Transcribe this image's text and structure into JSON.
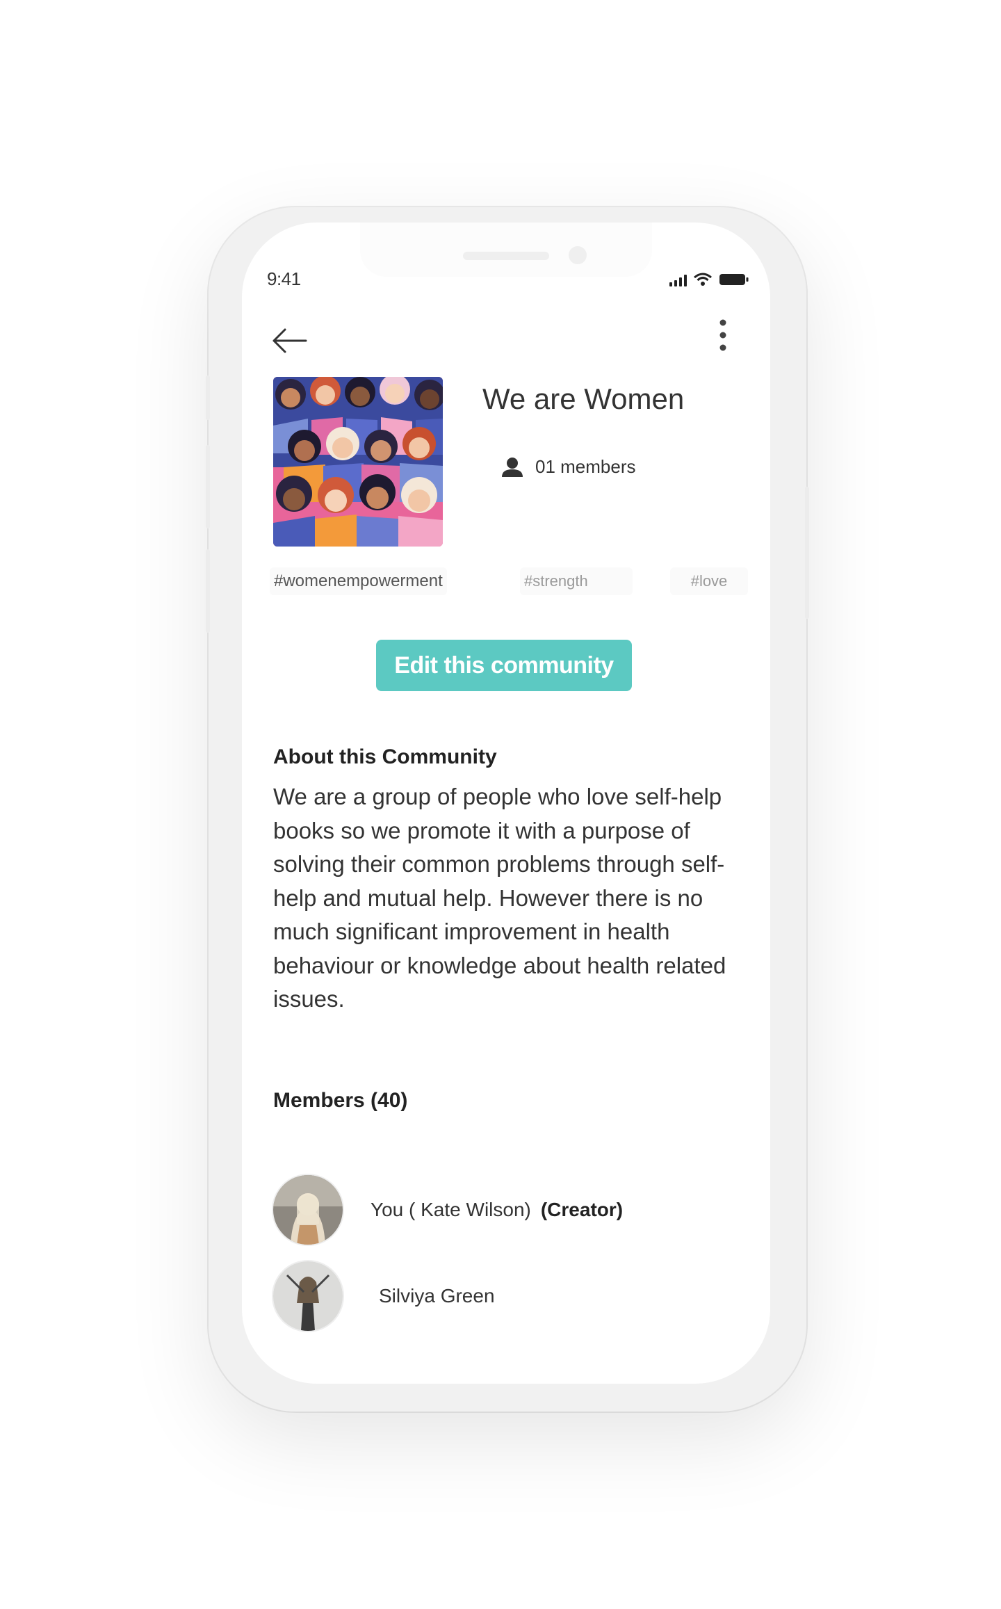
{
  "status_bar": {
    "time": "9:41"
  },
  "community": {
    "title": "We are Women",
    "members_count": "01 members",
    "tags": [
      "#womenempowerment",
      "#strength",
      "#love"
    ],
    "edit_button": "Edit this community"
  },
  "about": {
    "heading": "About this Community",
    "text": "We are a group of people who love self-help books so we promote it with a purpose of solving their common problems through self-help and mutual help. However there is no much significant improvement in health behaviour or knowledge about health related issues."
  },
  "members": {
    "heading": "Members (40)",
    "list": [
      {
        "name": "You ( Kate Wilson)",
        "role": "(Creator)"
      },
      {
        "name": "Silviya Green",
        "role": ""
      }
    ]
  },
  "colors": {
    "accent": "#5cc9c2"
  },
  "icons": [
    "back-arrow-icon",
    "more-vertical-icon",
    "person-icon",
    "signal-icon",
    "wifi-icon",
    "battery-icon"
  ]
}
